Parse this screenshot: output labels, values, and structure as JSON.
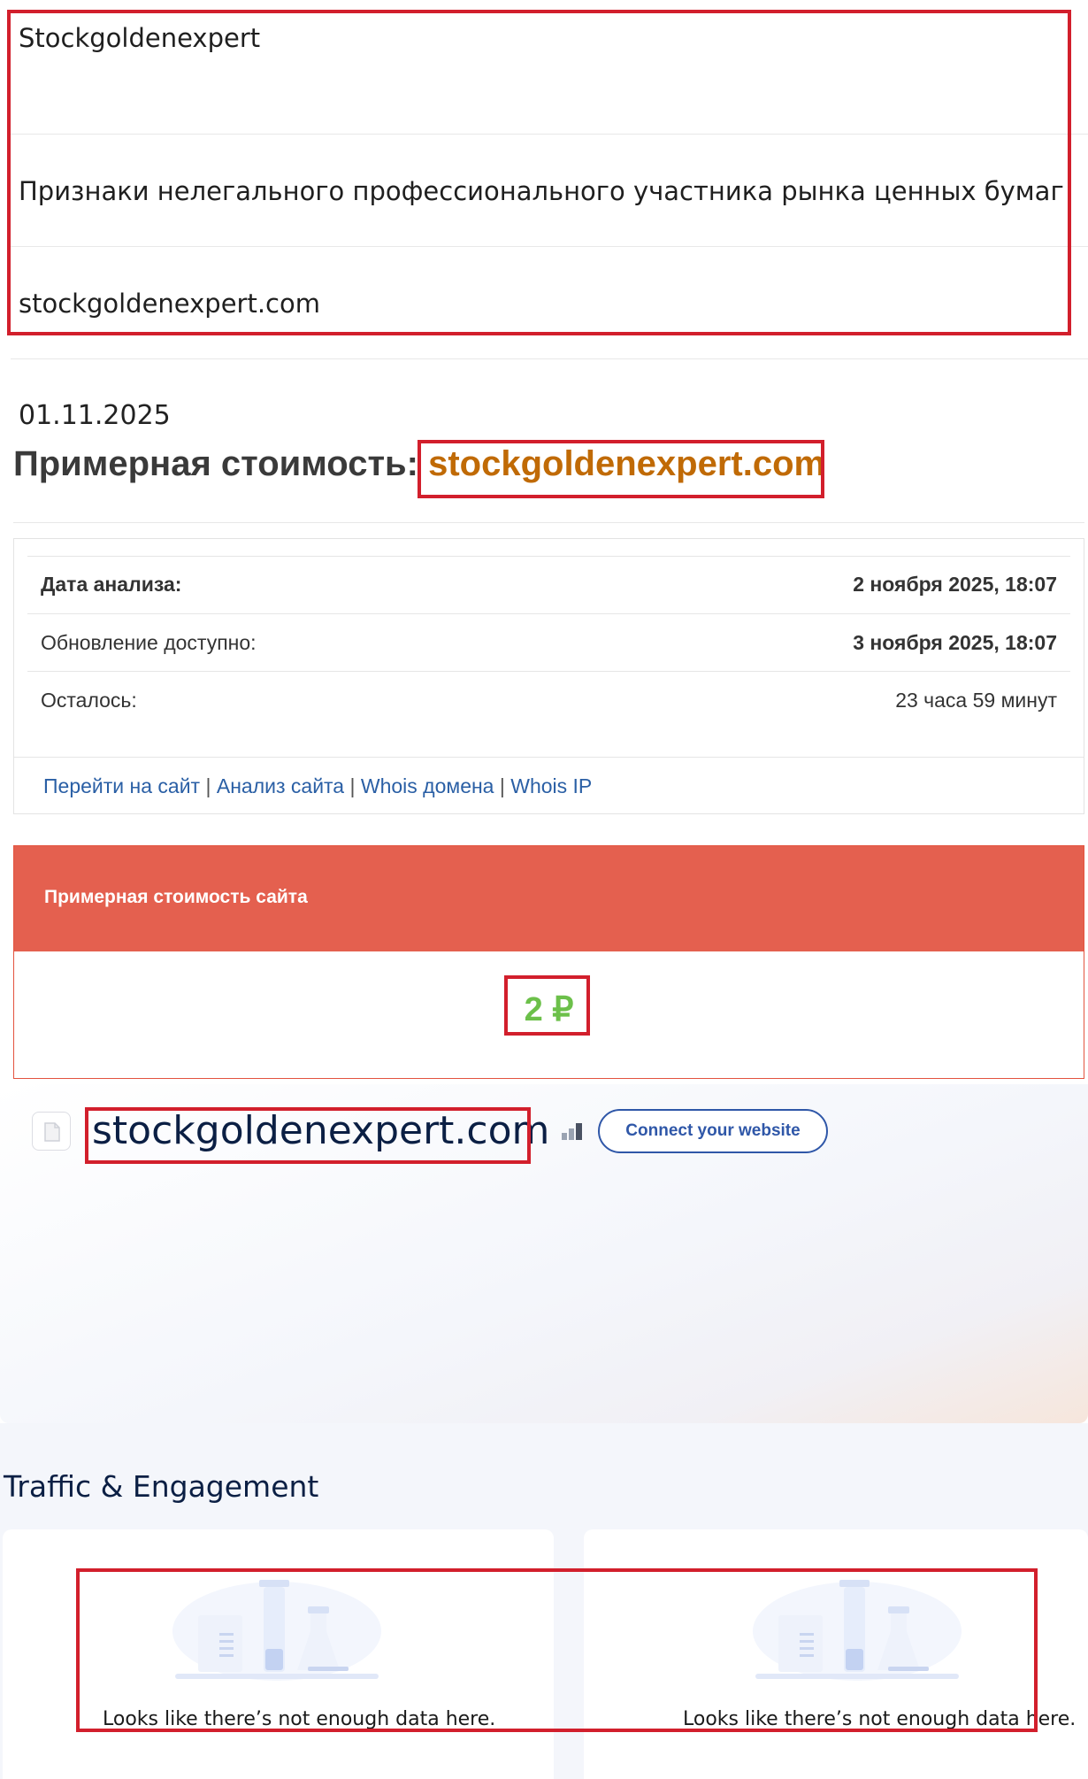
{
  "top": {
    "name": "Stockgoldenexpert",
    "description": "Признаки нелегального профессионального участника рынка ценных бумаг",
    "domain": "stockgoldenexpert.com"
  },
  "header": {
    "date": "01.11.2025",
    "cost_label": "Примерная стоимость:",
    "cost_domain": "stockgoldenexpert.com"
  },
  "info": {
    "rows": [
      {
        "label": "Дата анализа:",
        "value": "2 ноября 2025, 18:07"
      },
      {
        "label": "Обновление доступно:",
        "value": "3 ноября 2025, 18:07"
      },
      {
        "label": "Осталось:",
        "value": "23 часа 59 минут"
      }
    ],
    "links": [
      "Перейти на сайт",
      "Анализ сайта",
      "Whois домена",
      "Whois IP"
    ],
    "separator": "|"
  },
  "estimate": {
    "title": "Примерная стоимость сайта",
    "value": "2 ₽"
  },
  "hero": {
    "domain": "stockgoldenexpert.com",
    "connect_label": "Connect your website",
    "favicon_icon": "page-icon",
    "rank_icon": "bar-chart-icon"
  },
  "traffic": {
    "title": "Traffic & Engagement",
    "cards": [
      {
        "message": "Looks like there’s not enough data here."
      },
      {
        "message": "Looks like there’s not enough data here."
      }
    ]
  },
  "colors": {
    "highlight_border": "#d21f2c",
    "domain_orange": "#c06a05",
    "estimate_header": "#e4604f",
    "price_green": "#6cc04a",
    "link_blue": "#2a5fa5",
    "navy": "#0b1f44"
  }
}
